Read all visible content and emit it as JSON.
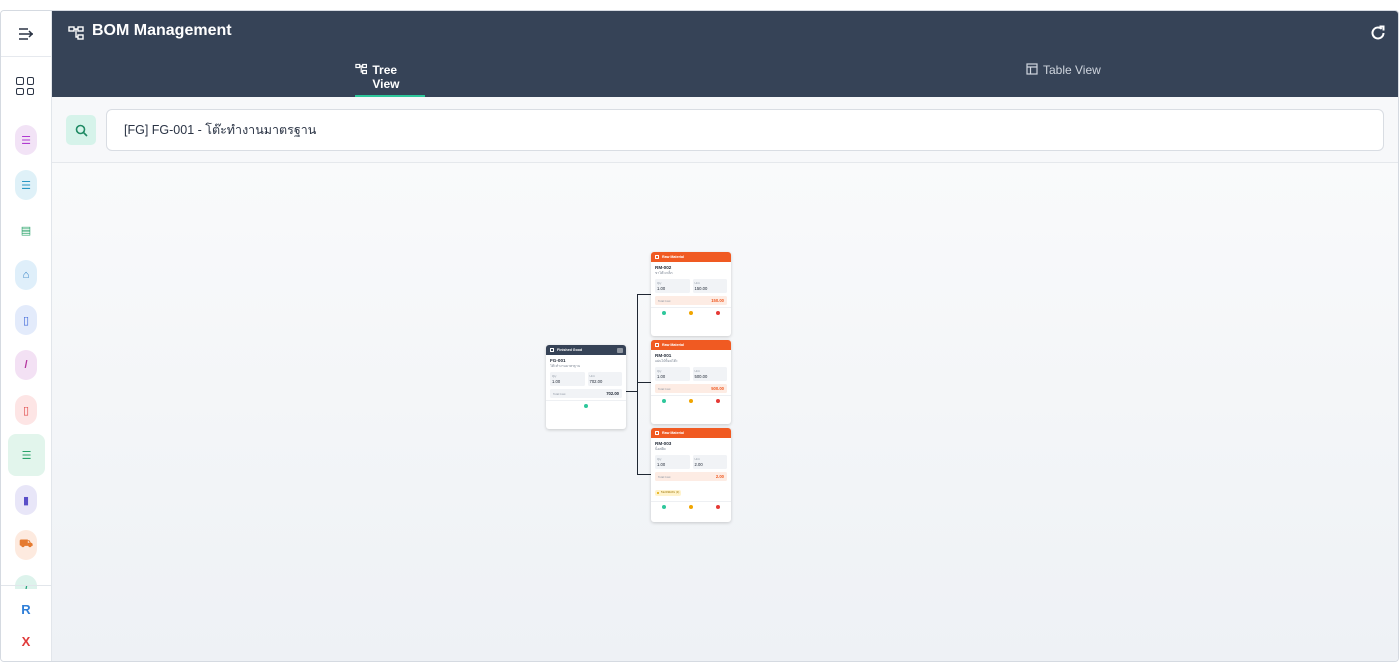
{
  "header": {
    "title": "BOM Management",
    "tabs": [
      {
        "label": "Tree View",
        "active": true
      },
      {
        "label": "Table View",
        "active": false
      }
    ]
  },
  "search": {
    "value": "[FG] FG-001 - โต๊ะทำงานมาตรฐาน"
  },
  "sidebar": {
    "bottom_letters": [
      "R",
      "X"
    ]
  },
  "tree": {
    "root": {
      "type_label": "Finished Good",
      "code": "FG-001",
      "name": "โต๊ะทำงานมาตรฐาน",
      "qty_label": "Qty",
      "qty": "1.00",
      "unit_label": "Unit",
      "unit_cost": "702.00",
      "total_label": "Total Cost",
      "total": "702.00"
    },
    "children": [
      {
        "type_label": "Raw Material",
        "code": "RM-002",
        "name": "ขาโต๊ะเหล็ก",
        "qty_label": "Qty",
        "qty": "1.00",
        "unit_label": "Unit",
        "unit_cost": "150.00",
        "total_label": "Total Cost",
        "total": "150.00"
      },
      {
        "type_label": "Raw Material",
        "code": "RM-001",
        "name": "แผ่นไม้ท็อปโต๊ะ",
        "qty_label": "Qty",
        "qty": "1.00",
        "unit_label": "Unit",
        "unit_cost": "500.00",
        "total_label": "Total Cost",
        "total": "500.00"
      },
      {
        "type_label": "Raw Material",
        "code": "RM-003",
        "name": "น็อตยึด",
        "qty_label": "Qty",
        "qty": "1.00",
        "unit_label": "Unit",
        "unit_cost": "2.00",
        "total_label": "Total Cost",
        "total": "2.00",
        "badge": "ของทดแทน (3)"
      }
    ]
  },
  "colors": {
    "header_bg": "#364357",
    "accent_green": "#2ec79b",
    "raw_material": "#f05a22",
    "finished_good": "#364357"
  }
}
